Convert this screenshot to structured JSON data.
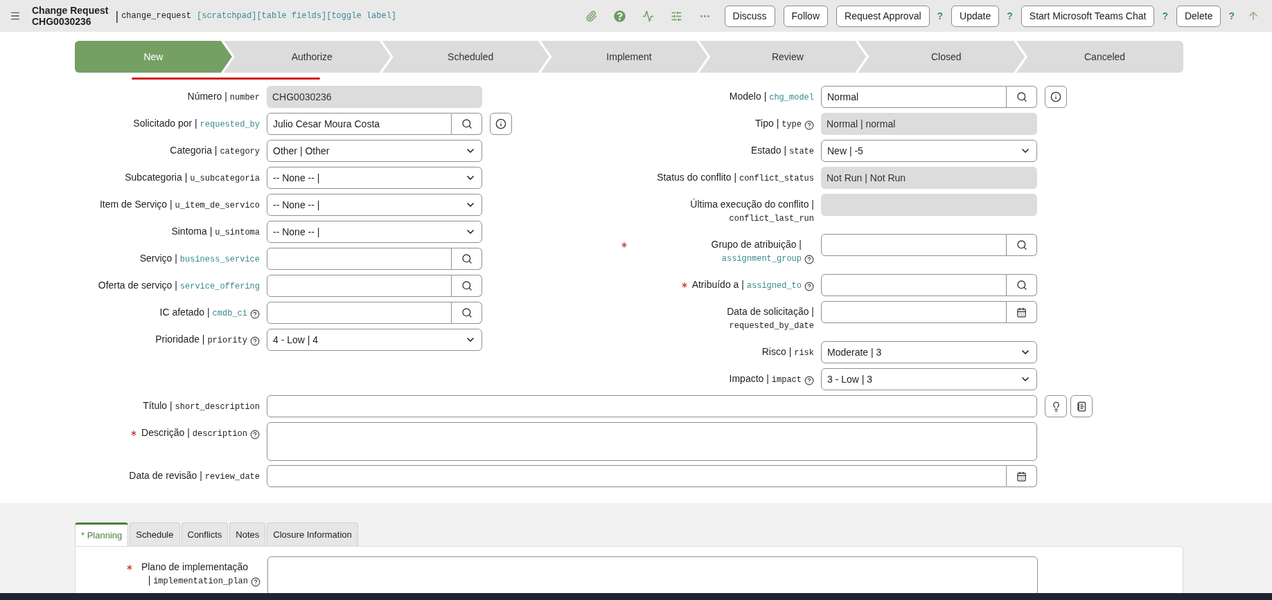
{
  "header": {
    "title": "Change Request",
    "number": "CHG0030236",
    "separator": "|",
    "table": "change_request",
    "links": "[scratchpad][table fields][toggle label]",
    "icons": [
      {
        "kind": "attach"
      },
      {
        "kind": "help"
      },
      {
        "kind": "activity"
      },
      {
        "kind": "settings"
      },
      {
        "kind": "more"
      }
    ],
    "actions": [
      {
        "kind": "button",
        "label": "Discuss"
      },
      {
        "kind": "button",
        "label": "Follow"
      },
      {
        "kind": "button",
        "label": "Request Approval"
      },
      {
        "kind": "help",
        "label": "?"
      },
      {
        "kind": "button",
        "label": "Update"
      },
      {
        "kind": "help",
        "label": "?"
      },
      {
        "kind": "button",
        "label": "Start Microsoft Teams Chat"
      },
      {
        "kind": "help",
        "label": "?"
      },
      {
        "kind": "button",
        "label": "Delete"
      },
      {
        "kind": "help",
        "label": "?"
      }
    ]
  },
  "stages": [
    {
      "label": "New",
      "selected": true
    },
    {
      "label": "Authorize",
      "selected": false
    },
    {
      "label": "Scheduled",
      "selected": false
    },
    {
      "label": "Implement",
      "selected": false
    },
    {
      "label": "Review",
      "selected": false
    },
    {
      "label": "Closed",
      "selected": false
    },
    {
      "label": "Canceled",
      "selected": false
    }
  ],
  "left_fields": [
    {
      "label": "Número |",
      "name": "number",
      "kind": "readonly",
      "value": "CHG0030236",
      "link": false,
      "required": false,
      "help": false,
      "info": false
    },
    {
      "label": "Solicitado por |",
      "name": "requested_by",
      "kind": "reference",
      "value": "Julio Cesar Moura Costa",
      "link": true,
      "required": false,
      "help": false,
      "info": true
    },
    {
      "label": "Categoria |",
      "name": "category",
      "kind": "select",
      "value": "Other | Other",
      "link": false,
      "required": false,
      "help": false,
      "info": false
    },
    {
      "label": "Subcategoria |",
      "name": "u_subcategoria",
      "kind": "select",
      "value": "-- None -- |",
      "link": false,
      "required": false,
      "help": false,
      "info": false
    },
    {
      "label": "Item de Serviço |",
      "name": "u_item_de_servico",
      "kind": "select",
      "value": "-- None -- |",
      "link": false,
      "required": false,
      "help": false,
      "info": false
    },
    {
      "label": "Sintoma |",
      "name": "u_sintoma",
      "kind": "select",
      "value": "-- None -- |",
      "link": false,
      "required": false,
      "help": false,
      "info": false
    },
    {
      "label": "Serviço |",
      "name": "business_service",
      "kind": "reference",
      "link": true,
      "required": false,
      "help": false,
      "info": false
    },
    {
      "label": "Oferta de serviço |",
      "name": "service_offering",
      "kind": "reference",
      "link": true,
      "required": false,
      "help": false,
      "info": false
    },
    {
      "label": "IC afetado |",
      "name": "cmdb_ci",
      "kind": "reference",
      "link": true,
      "required": false,
      "help": true,
      "info": false
    },
    {
      "label": "Prioridade |",
      "name": "priority",
      "kind": "select",
      "value": "4 - Low | 4",
      "link": false,
      "required": false,
      "help": true,
      "info": false
    }
  ],
  "right_fields": [
    {
      "label": "Modelo |",
      "name": "chg_model",
      "kind": "reference",
      "value": "Normal",
      "link": true,
      "required": false,
      "help": false,
      "info": true
    },
    {
      "label": "Tipo |",
      "name": "type",
      "kind": "readonly",
      "value": "Normal | normal",
      "link": false,
      "required": false,
      "help": true,
      "info": false
    },
    {
      "label": "Estado |",
      "name": "state",
      "kind": "select",
      "value": "New | -5",
      "link": false,
      "required": false,
      "help": false,
      "info": false
    },
    {
      "label": "Status do conflito |",
      "name": "conflict_status",
      "kind": "readonly",
      "value": "Not Run | Not Run",
      "link": false,
      "required": false,
      "help": false,
      "info": false
    },
    {
      "label": "Última execução do conflito |",
      "name": "conflict_last_run",
      "kind": "readonly",
      "link": false,
      "required": false,
      "help": false,
      "info": false
    },
    {
      "label": "Grupo de atribuição |",
      "name": "assignment_group",
      "kind": "reference",
      "link": true,
      "required": true,
      "help": true,
      "info": false
    },
    {
      "label": "Atribuído a |",
      "name": "assigned_to",
      "kind": "reference",
      "link": true,
      "required": true,
      "help": true,
      "info": false
    },
    {
      "label": "Data de solicitação |",
      "name": "requested_by_date",
      "kind": "date",
      "link": false,
      "required": false,
      "help": false,
      "info": false
    },
    {
      "label": "Risco |",
      "name": "risk",
      "kind": "select",
      "value": "Moderate | 3",
      "link": false,
      "required": false,
      "help": false,
      "info": false
    },
    {
      "label": "Impacto |",
      "name": "impact",
      "kind": "select",
      "value": "3 - Low | 3",
      "link": false,
      "required": false,
      "help": true,
      "info": false
    }
  ],
  "wide_fields": [
    {
      "label": "Título |",
      "name": "short_description",
      "kind": "text",
      "link": false,
      "required": false,
      "help": false,
      "extras": [
        {
          "kind": "suggest"
        },
        {
          "kind": "template"
        }
      ]
    },
    {
      "label": "Descrição |",
      "name": "description",
      "kind": "textarea",
      "link": false,
      "required": true,
      "help": true
    },
    {
      "label": "Data de revisão |",
      "name": "review_date",
      "kind": "date",
      "link": false,
      "required": false,
      "help": false
    }
  ],
  "tabs": [
    {
      "label": "* Planning",
      "selected": true
    },
    {
      "label": "Schedule",
      "selected": false
    },
    {
      "label": "Conflicts",
      "selected": false
    },
    {
      "label": "Notes",
      "selected": false
    },
    {
      "label": "Closure Information",
      "selected": false
    }
  ],
  "tab_fields": [
    {
      "label": "Plano de implementação |",
      "name": "implementation_plan",
      "kind": "textarea",
      "link": false,
      "required": true,
      "help": true
    }
  ]
}
